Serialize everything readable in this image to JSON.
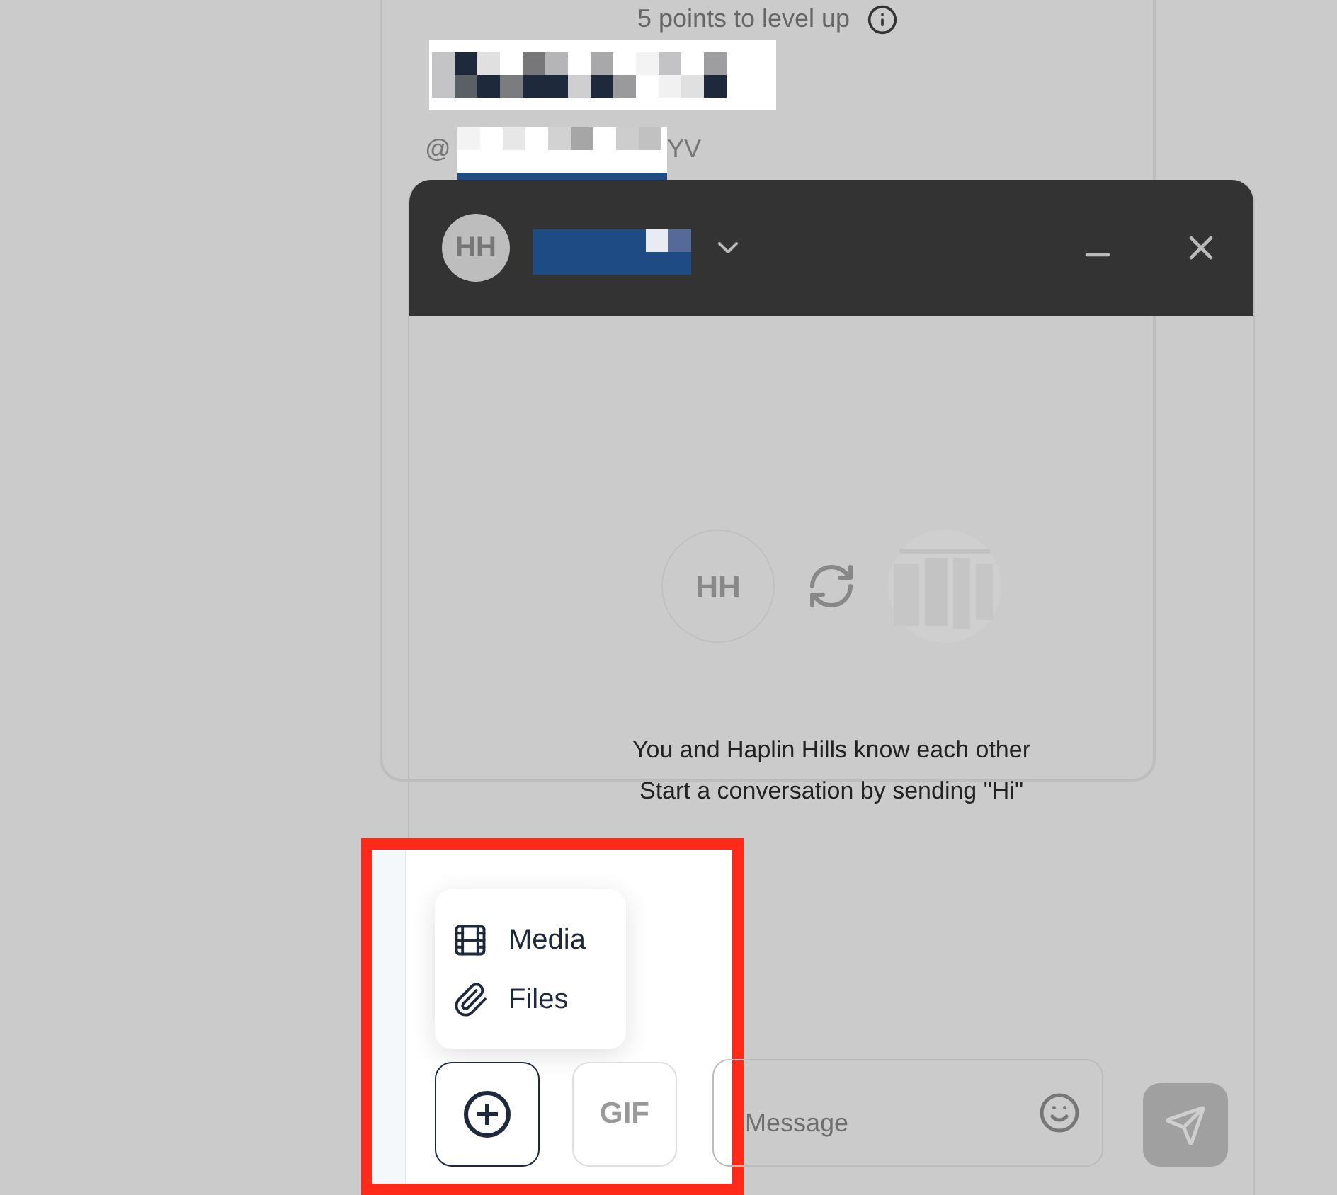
{
  "progress": {
    "text": "5 points to level up"
  },
  "profile": {
    "handle_start": "@",
    "handle_end": "YV"
  },
  "chat": {
    "avatar": "HH",
    "peer_avatar": "HH",
    "message_lines": [
      "You and Haplin Hills know each other",
      "Start a conversation by sending \"Hi\""
    ],
    "attach_menu": [
      {
        "label": "Media",
        "kind": "media"
      },
      {
        "label": "Files",
        "kind": "files"
      }
    ],
    "gif": "GIF",
    "placeholder": "Message"
  }
}
